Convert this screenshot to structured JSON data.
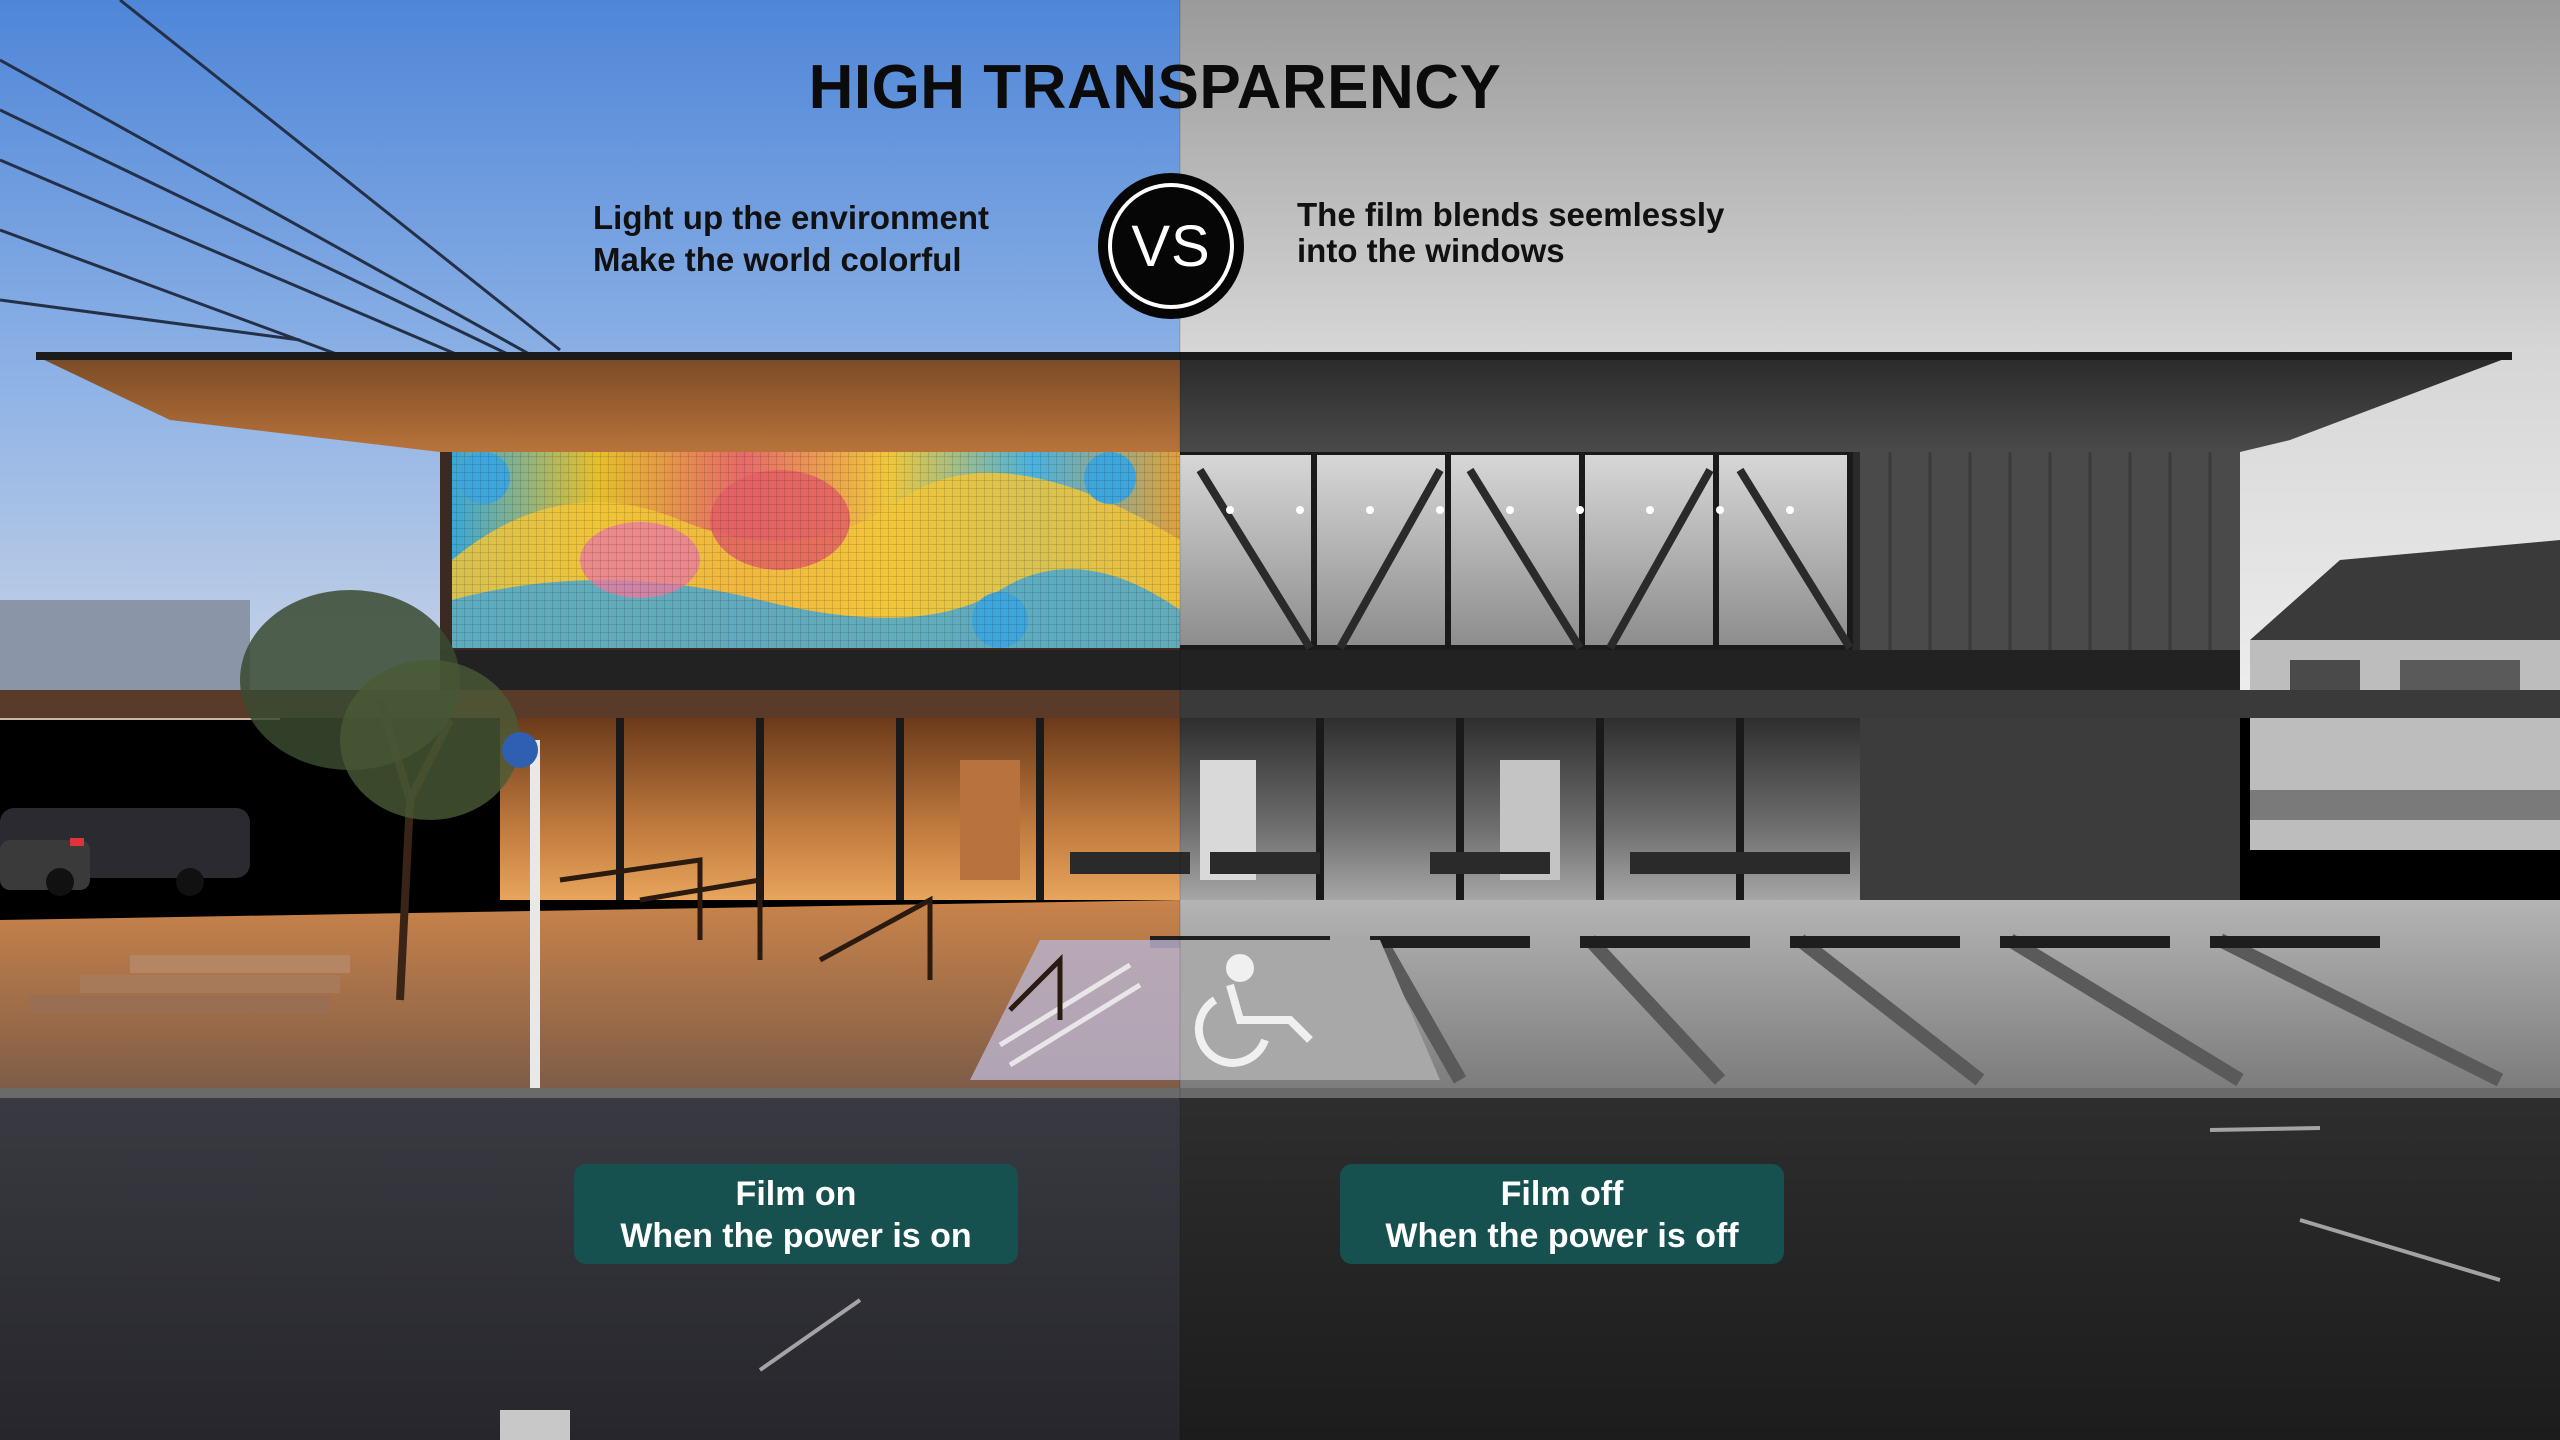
{
  "headline": "HIGH TRANSPARENCY",
  "left_claim": {
    "line1": "Light up the environment",
    "line2": "Make the world colorful"
  },
  "right_claim": {
    "line1": "The film blends seemlessly",
    "line2": "into the windows"
  },
  "vs_badge": "VS",
  "film_on_label": {
    "line1": "Film on",
    "line2": "When the power is on"
  },
  "film_off_label": {
    "line1": "Film off",
    "line2": "When the power is off"
  },
  "colors": {
    "label_background": "#16514f",
    "sky_blue": "#5b8fd6",
    "warm_light": "#d98a3c",
    "grayscale_side": "#8a8a8a"
  }
}
